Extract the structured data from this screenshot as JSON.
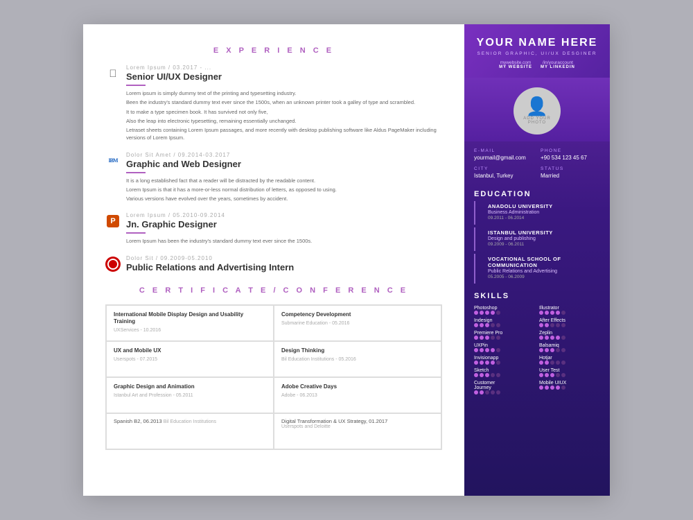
{
  "left": {
    "experience_title": "E X P E R I E N C E",
    "cert_title": "C E R T I F I C A T E / C O N F E R E N C E",
    "jobs": [
      {
        "id": "job1",
        "logo": "apple",
        "date": "Lorem Ipsum / 03.2017 - ...",
        "title": "Senior UI/UX Designer",
        "body": [
          "Lorem ipsum is simply dummy text of the printing and typesetting industry.",
          "Been the industry's standard dummy text ever since the 1500s, when an unknown printer took a galley of type and scrambled.",
          "It to make a type specimen book. It has survived not only five,",
          "Also the leap into electronic typesetting, remaining essentially unchanged.",
          "Letraset sheets containing Lorem Ipsum passages, and more recently with desktop publishing software like Aldus PageMaker including versions of Lorem Ipsum."
        ]
      },
      {
        "id": "job2",
        "logo": "ibm",
        "date": "Dolor Sit Amet / 09.2014-03.2017",
        "title": "Graphic and Web Designer",
        "body": [
          "It is a long established fact that a reader will be distracted by the readable content.",
          "Lorem Ipsum is that it has a more-or-less normal distribution of letters, as opposed to using.",
          "Various versions have evolved over the years, sometimes by accident."
        ]
      },
      {
        "id": "job3",
        "logo": "paypal",
        "date": "Lorem Ipsum / 05.2010-09.2014",
        "title": "Jn. Graphic Designer",
        "body": [
          "Lorem Ipsum has been the industry's standard dummy text ever since the 1500s."
        ]
      },
      {
        "id": "job4",
        "logo": "thy",
        "date": "Dolor Sit / 09.2009-05.2010",
        "title": "Public Relations and Advertising Intern",
        "body": []
      }
    ],
    "certs": [
      {
        "title": "International Mobile Display Design and Usability Training",
        "sub": "UXServices - 10.2016"
      },
      {
        "title": "Competency Development",
        "sub": "Submarine Education - 05.2016"
      },
      {
        "title": "UX and Mobile UX",
        "sub": "Userspots - 07.2015"
      },
      {
        "title": "Design Thinking",
        "sub": "Bil Education Institutions - 05.2016"
      },
      {
        "title": "Graphic Design and Animation",
        "sub": "Istanbul Art and Profession - 05.2011"
      },
      {
        "title": "Adobe Creative Days",
        "sub": "Adobe - 06.2013"
      },
      {
        "title": "Spanish B2, 06.2013",
        "sub": "Bil Education Institutions"
      },
      {
        "title": "Digital Transformation & UX Strategy, 01.2017",
        "sub": "Userspots and Deloitte"
      }
    ]
  },
  "right": {
    "name": "YOUR NAME HERE",
    "subtitle": "SENIOR GRAPHIC, UI/UX DESGINER",
    "website_label": "MY WEBSITE",
    "website_url": "mywebsite.com",
    "linkedin_label": "MY LINKEDIN",
    "linkedin_url": "/in/youraccount",
    "photo_text": "ADD YOUR\nPHOTO",
    "email_label": "E-MAIL",
    "email_value": "yourmail@gmail.com",
    "phone_label": "PHONE",
    "phone_value": "+90 534 123 45 67",
    "city_label": "CITY",
    "city_value": "Istanbul, Turkey",
    "status_label": "STATUS",
    "status_value": "Married",
    "education_title": "EDUCATION",
    "education": [
      {
        "school": "ANADOLU UNIVERSITY",
        "degree": "Business Administration",
        "dates": "09.2011 - 06.2014"
      },
      {
        "school": "ISTANBUL UNIVERSITY",
        "degree": "Design and publishing",
        "dates": "09.2009 - 06.2011"
      },
      {
        "school": "VOCATIONAL SCHOOL OF\nCOMMUNICATION",
        "degree": "Public Relations and Advertising",
        "dates": "05.2005 - 06.2009"
      }
    ],
    "skills_title": "SKILLS",
    "skills": [
      {
        "name": "Photoshop",
        "filled": 4,
        "empty": 1
      },
      {
        "name": "Illustrator",
        "filled": 4,
        "empty": 1
      },
      {
        "name": "Indesign",
        "filled": 3,
        "empty": 2
      },
      {
        "name": "After Effects",
        "filled": 2,
        "empty": 3
      },
      {
        "name": "Premiere Pro",
        "filled": 3,
        "empty": 2
      },
      {
        "name": "Zeplin",
        "filled": 4,
        "empty": 1
      },
      {
        "name": "UXPin",
        "filled": 4,
        "empty": 1
      },
      {
        "name": "Balsamiq",
        "filled": 3,
        "empty": 2
      },
      {
        "name": "Invisionapp",
        "filled": 4,
        "empty": 1
      },
      {
        "name": "Hotjar",
        "filled": 2,
        "empty": 3
      },
      {
        "name": "Sketch",
        "filled": 3,
        "empty": 2
      },
      {
        "name": "User Test",
        "filled": 3,
        "empty": 2
      },
      {
        "name": "Customer Journey",
        "filled": 2,
        "empty": 3
      },
      {
        "name": "Mobile UIUX",
        "filled": 4,
        "empty": 1
      }
    ]
  }
}
